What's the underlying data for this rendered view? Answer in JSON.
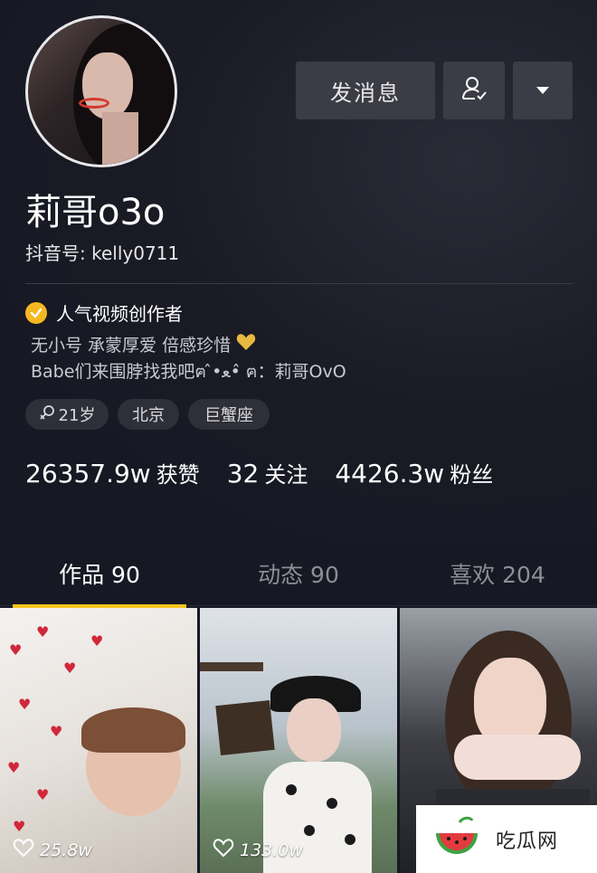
{
  "profile": {
    "nickname": "莉哥o3o",
    "douyin_id": "抖音号: kelly0711",
    "verified_label": "人气视频创作者",
    "bio_line1": "无小号 承蒙厚爱 倍感珍惜",
    "bio_line2": "Babe们来围脖找我吧ฅ ̂•ﻌ• ̂ฅ：莉哥OvO",
    "tags": {
      "age": "21岁",
      "city": "北京",
      "zodiac": "巨蟹座"
    }
  },
  "actions": {
    "message_label": "发消息"
  },
  "stats": {
    "likes_value": "26357.9w",
    "likes_label": "获赞",
    "following_value": "32",
    "following_label": "关注",
    "followers_value": "4426.3w",
    "followers_label": "粉丝"
  },
  "tabs": [
    {
      "label": "作品 90",
      "active": true
    },
    {
      "label": "动态 90",
      "active": false
    },
    {
      "label": "喜欢 204",
      "active": false
    }
  ],
  "videos": [
    {
      "likes": "25.8w"
    },
    {
      "likes": "133.0w"
    },
    {
      "likes": ""
    }
  ],
  "watermark": {
    "text": "吃瓜网"
  },
  "colors": {
    "accent": "#f6c41a",
    "background": "#161823",
    "verified": "#f6b820"
  }
}
